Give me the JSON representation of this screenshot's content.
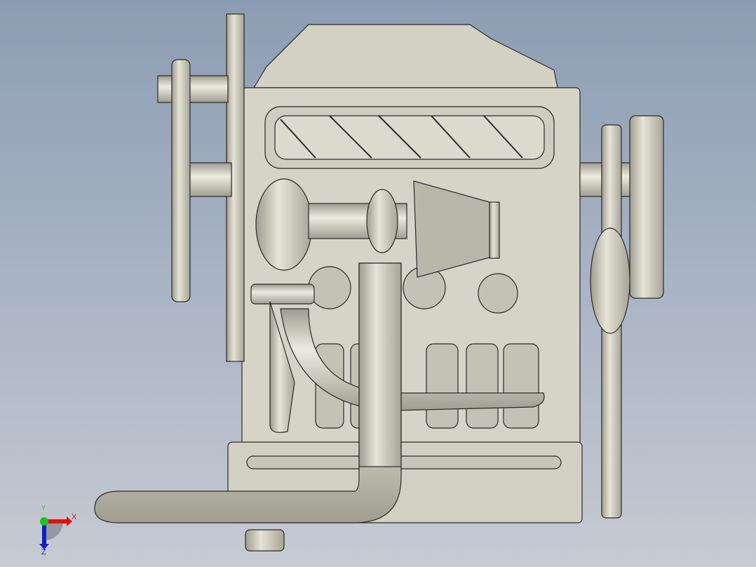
{
  "viewport": {
    "model": "engine-assembly"
  },
  "triad": {
    "x_label": "X",
    "y_label": "Y",
    "z_label": "Z"
  },
  "colors": {
    "model_fill": "#d8d6c8",
    "model_shade": "#a9a799",
    "edge": "#2a2a2a",
    "x_axis": "#e01010",
    "y_axis": "#20c020",
    "z_axis": "#1020c0"
  }
}
